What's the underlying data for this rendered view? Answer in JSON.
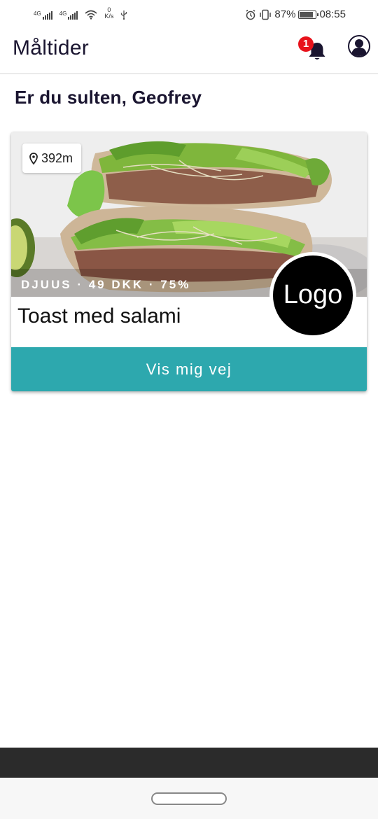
{
  "status_bar": {
    "net1": "4G",
    "net2": "4G",
    "speed_value": "0",
    "speed_unit": "K/s",
    "battery_percent": "87%",
    "battery_level": 0.87,
    "time": "08:55"
  },
  "app_bar": {
    "title": "Måltider",
    "notification_count": "1"
  },
  "greeting": "Er du sulten, Geofrey",
  "card": {
    "distance": "392m",
    "meta": "DJUUS · 49 DKK · 75%",
    "dish_name": "Toast med salami",
    "logo_text": "Logo",
    "action_label": "Vis mig vej"
  },
  "colors": {
    "accent": "#2da8ae",
    "badge": "#e8121b",
    "title_text": "#1a1530"
  },
  "icons": {
    "location": "map-pin-icon",
    "notifications": "bell-icon",
    "account": "account-circle-icon"
  }
}
